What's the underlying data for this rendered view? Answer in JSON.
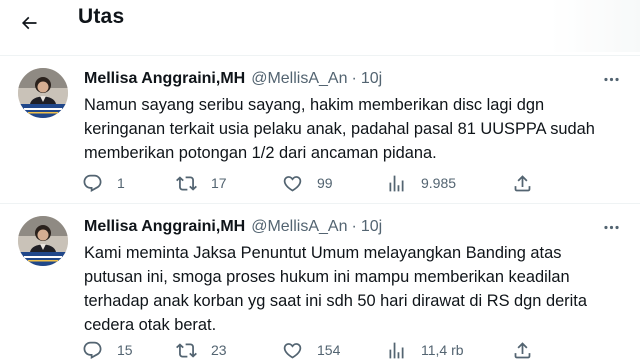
{
  "header": {
    "title": "Utas"
  },
  "tweets": [
    {
      "author": {
        "name": "Mellisa Anggraini,MH",
        "handle": "@MellisA_An"
      },
      "separator": "·",
      "time": "10j",
      "lines": [
        "Namun sayang seribu sayang, hakim memberikan disc lagi dgn",
        "keringanan terkait usia pelaku anak, padahal pasal 81 UUSPPA sudah",
        "memberikan potongan 1/2 dari ancaman pidana."
      ],
      "stats": {
        "replies": "1",
        "retweets": "17",
        "likes": "99",
        "views": "9.985"
      }
    },
    {
      "author": {
        "name": "Mellisa Anggraini,MH",
        "handle": "@MellisA_An"
      },
      "separator": "·",
      "time": "10j",
      "lines": [
        "Kami meminta Jaksa Penuntut Umum melayangkan Banding atas",
        "putusan ini, smoga proses hukum ini mampu memberikan keadilan",
        "terhadap anak korban yg saat ini sdh 50 hari dirawat di RS dgn derita",
        "cedera otak berat."
      ],
      "stats": {
        "replies": "15",
        "retweets": "23",
        "likes": "154",
        "views": "11,4 rb"
      }
    }
  ],
  "icons": {
    "back": "arrow-left-icon",
    "more": "more-horizontal-icon",
    "reply": "reply-icon",
    "retweet": "retweet-icon",
    "like": "heart-icon",
    "views": "views-chart-icon",
    "share": "share-icon"
  },
  "colors": {
    "text": "#0f1419",
    "secondary": "#536471",
    "divider": "#eff3f4"
  }
}
